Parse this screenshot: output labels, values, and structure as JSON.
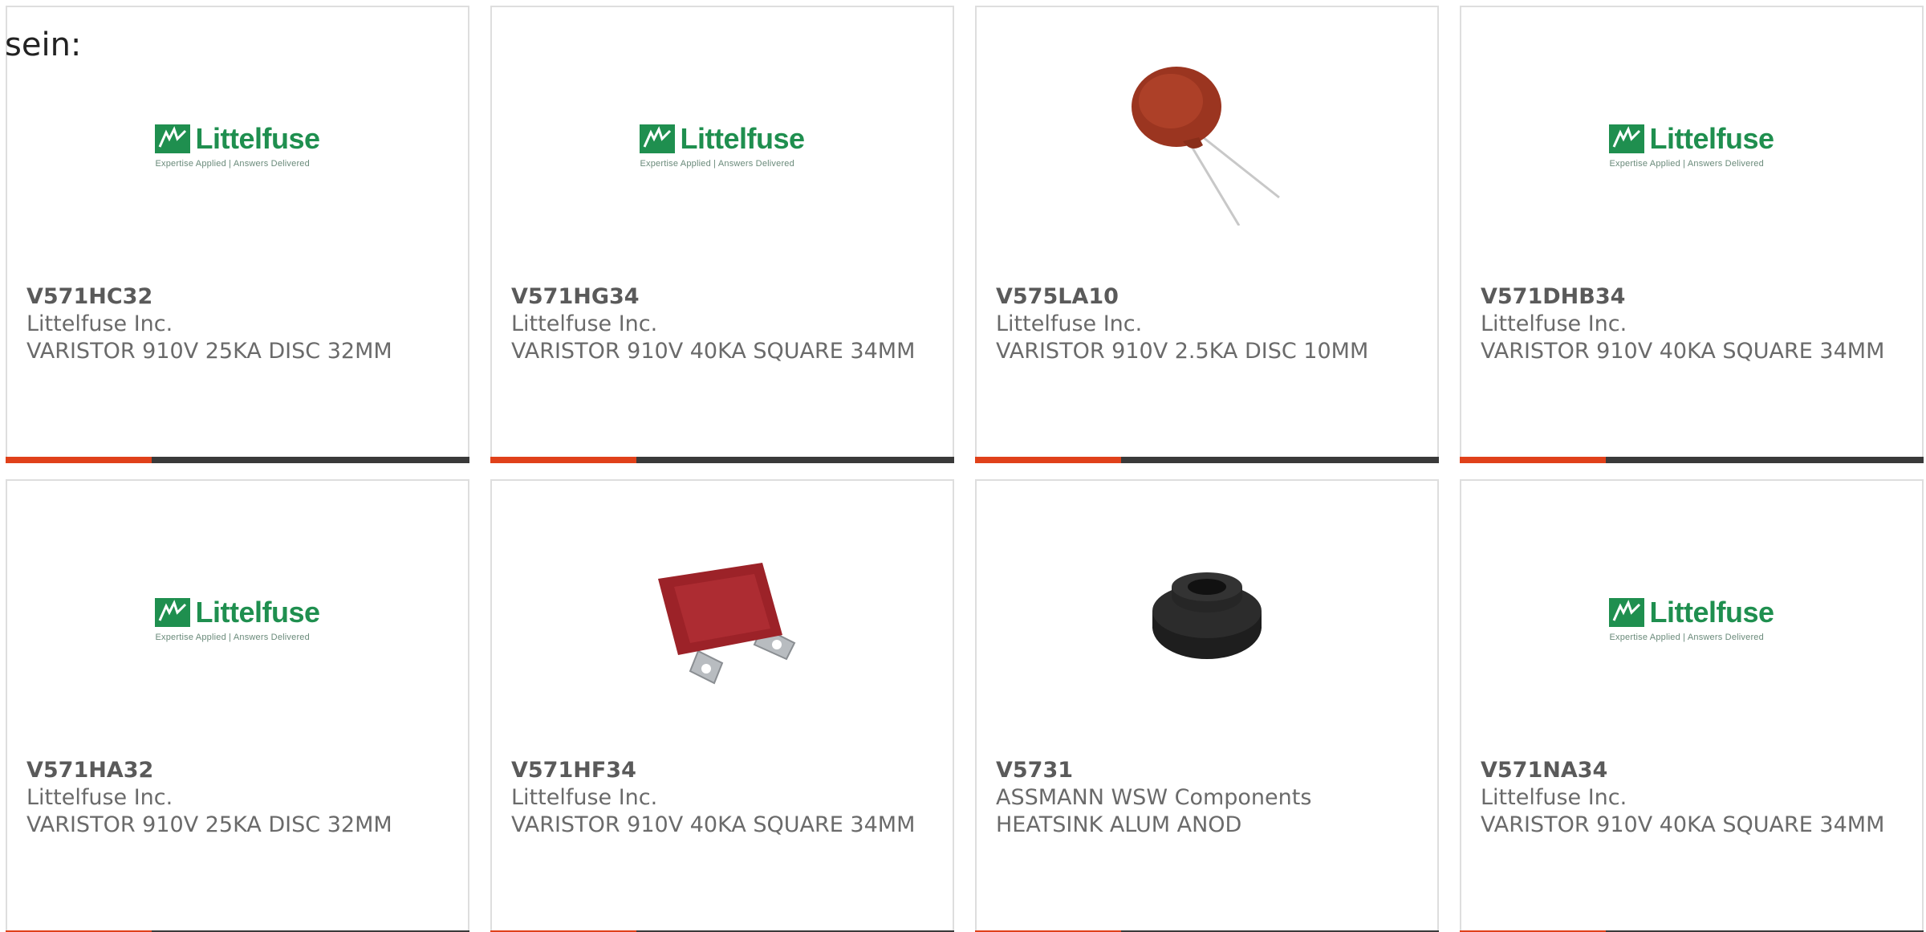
{
  "intro": {
    "text": "sein:"
  },
  "colors": {
    "accent": "#e0411a",
    "bar": "#3a3a3a",
    "logo_green": "#1f8f4f"
  },
  "logo": {
    "word": "Littelfuse",
    "tagline": "Expertise Applied | Answers Delivered"
  },
  "products": [
    {
      "part_number": "V571HC32",
      "manufacturer": "Littelfuse Inc.",
      "description": "VARISTOR 910V 25KA DISC 32MM",
      "image": "littelfuse-logo"
    },
    {
      "part_number": "V571HG34",
      "manufacturer": "Littelfuse Inc.",
      "description": "VARISTOR 910V 40KA SQUARE 34MM",
      "image": "littelfuse-logo"
    },
    {
      "part_number": "V575LA10",
      "manufacturer": "Littelfuse Inc.",
      "description": "VARISTOR 910V 2.5KA DISC 10MM",
      "image": "disc-varistor-photo"
    },
    {
      "part_number": "V571DHB34",
      "manufacturer": "Littelfuse Inc.",
      "description": "VARISTOR 910V 40KA SQUARE 34MM",
      "image": "littelfuse-logo"
    },
    {
      "part_number": "V571HA32",
      "manufacturer": "Littelfuse Inc.",
      "description": "VARISTOR 910V 25KA DISC 32MM",
      "image": "littelfuse-logo"
    },
    {
      "part_number": "V571HF34",
      "manufacturer": "Littelfuse Inc.",
      "description": "VARISTOR 910V 40KA SQUARE 34MM",
      "image": "square-varistor-photo"
    },
    {
      "part_number": "V5731",
      "manufacturer": "ASSMANN WSW Components",
      "description": "HEATSINK ALUM ANOD",
      "image": "heatsink-photo"
    },
    {
      "part_number": "V571NA34",
      "manufacturer": "Littelfuse Inc.",
      "description": "VARISTOR 910V 40KA SQUARE 34MM",
      "image": "littelfuse-logo"
    }
  ]
}
